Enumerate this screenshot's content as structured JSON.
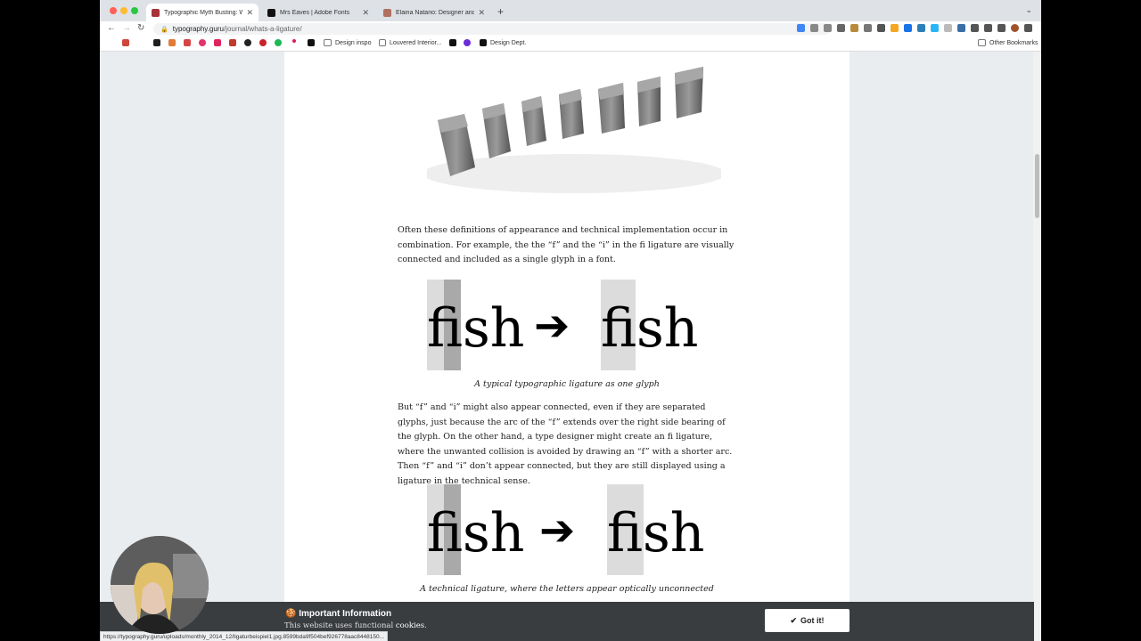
{
  "browser": {
    "tabs": [
      {
        "title": "Typographic Myth Busting: Wh",
        "favicon_color": "#a8323a",
        "active": true
      },
      {
        "title": "Mrs Eaves | Adobe Fonts",
        "favicon_color": "#111111",
        "active": false
      },
      {
        "title": "Elaina Natario: Designer and D",
        "favicon_color": "#b07060",
        "active": false
      }
    ],
    "new_tab": "+",
    "url_domain": "typography.guru",
    "url_path": "/journal/whats-a-ligature/",
    "bookmarks": [
      "Design inspo",
      "Louvered Interior...",
      "Design Dept."
    ],
    "other_bookmarks": "Other Bookmarks"
  },
  "article": {
    "paragraph1": "Often these definitions of appearance and technical implementation occur in combination. For example, the the “f” and the “i” in the  fi ligature are visually connected and included as a single glyph in a font.",
    "figure1_word_left": "fish",
    "figure1_word_right": "fish",
    "figure1_arrow": "➔",
    "caption1": "A typical typographic ligature as one glyph",
    "paragraph2": "But “f” and “i” might also appear connected, even if they are separated glyphs, just because the arc of the “f” extends over the right side bearing of the glyph. On the other hand, a type designer might create an fi ligature, where the unwanted collision is avoided by drawing an “f” with a shorter arc. Then “f” and “i” don’t appear connected, but they are still displayed using a ligature in the technical sense.",
    "figure2_word_left": "fish",
    "figure2_word_right": "fish",
    "figure2_arrow": "➔",
    "caption2": "A technical ligature, where the letters appear optically unconnected"
  },
  "cookie": {
    "icon": "🍪",
    "title": "Important Information",
    "text": "This website uses functional ",
    "link": "cookies",
    "text_end": ".",
    "button_icon": "✔",
    "button": "Got it!"
  },
  "status_url": "https://typography.guru/uploads/monthly_2014_12/ligaturbeispiel1.jpg.8599bda9f504bef926778aac8448150..."
}
